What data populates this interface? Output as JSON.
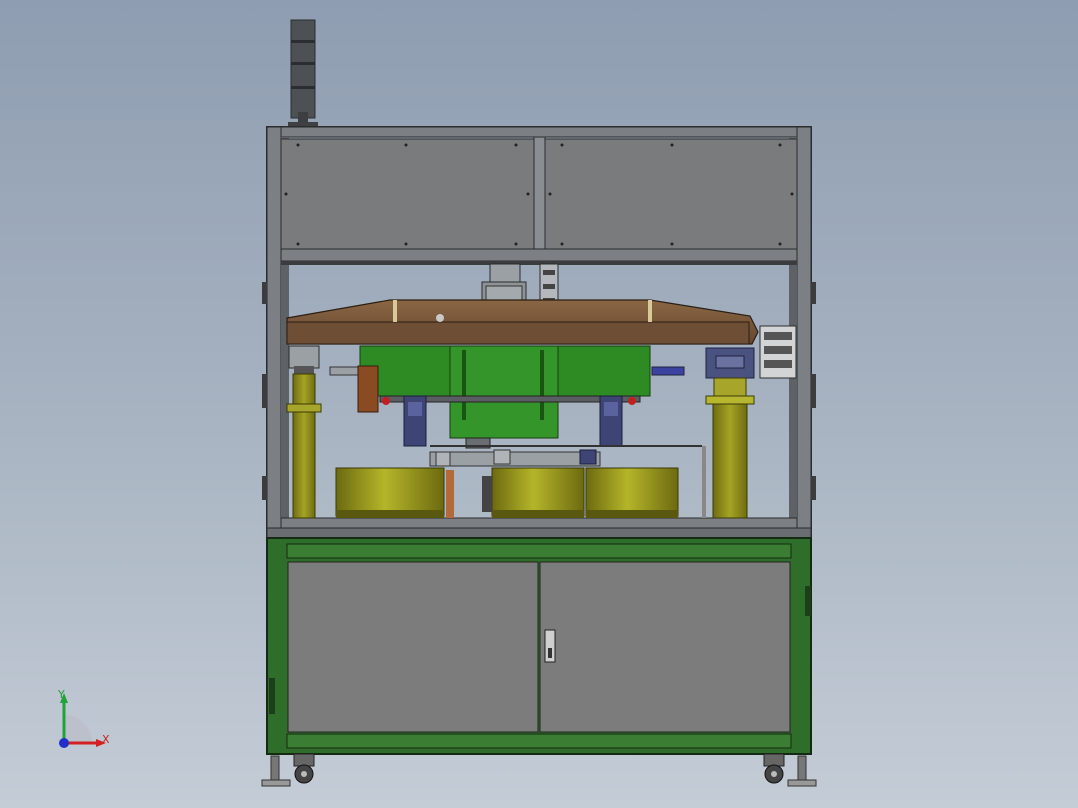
{
  "triad": {
    "x_label": "X",
    "y_label": "Y",
    "colors": {
      "x": "#d42020",
      "y": "#21a33a",
      "z": "#2030c8"
    }
  },
  "colors": {
    "background_top": "#8e9db1",
    "frame": "#6f7478",
    "panel": "#7a7b7c",
    "plate": "#7a5a3e",
    "module": "#2e8a22",
    "column": "#8a8a18",
    "cabinet": "#2f6e2a",
    "door": "#7c7c7c"
  }
}
